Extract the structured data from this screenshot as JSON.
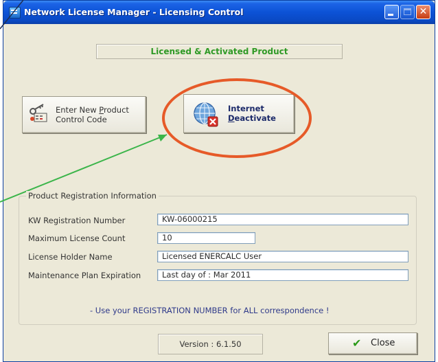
{
  "window": {
    "title": "Network License Manager - Licensing Control"
  },
  "status_banner": "Licensed & Activated Product",
  "buttons": {
    "enter_code": {
      "line1": "Enter New ",
      "accel": "P",
      "rest": "roduct",
      "line2": "Control Code"
    },
    "internet": {
      "line1": "Internet",
      "accel": "D",
      "rest": "eactivate"
    },
    "close": "Close"
  },
  "registration": {
    "legend": "Product Registration Information",
    "rows": [
      {
        "label": "KW Registration Number",
        "value": "KW-06000215"
      },
      {
        "label": "Maximum License Count",
        "value": "10"
      },
      {
        "label": "License Holder Name",
        "value": "Licensed ENERCALC User"
      },
      {
        "label": "Maintenance Plan Expiration",
        "value": "Last day of : Mar 2011"
      }
    ],
    "separator": ":",
    "note": "- Use your REGISTRATION NUMBER for ALL correspondence !"
  },
  "version": "Version : 6.1.50",
  "icons": {
    "app": "app-window-icon",
    "enter": "keys-icon",
    "internet": "globe-deactivate-icon",
    "close": "checkmark-icon"
  },
  "colors": {
    "annotation_circle": "#e65a28",
    "annotation_arrow": "#3bb54a",
    "banner_text": "#2f9a26"
  }
}
